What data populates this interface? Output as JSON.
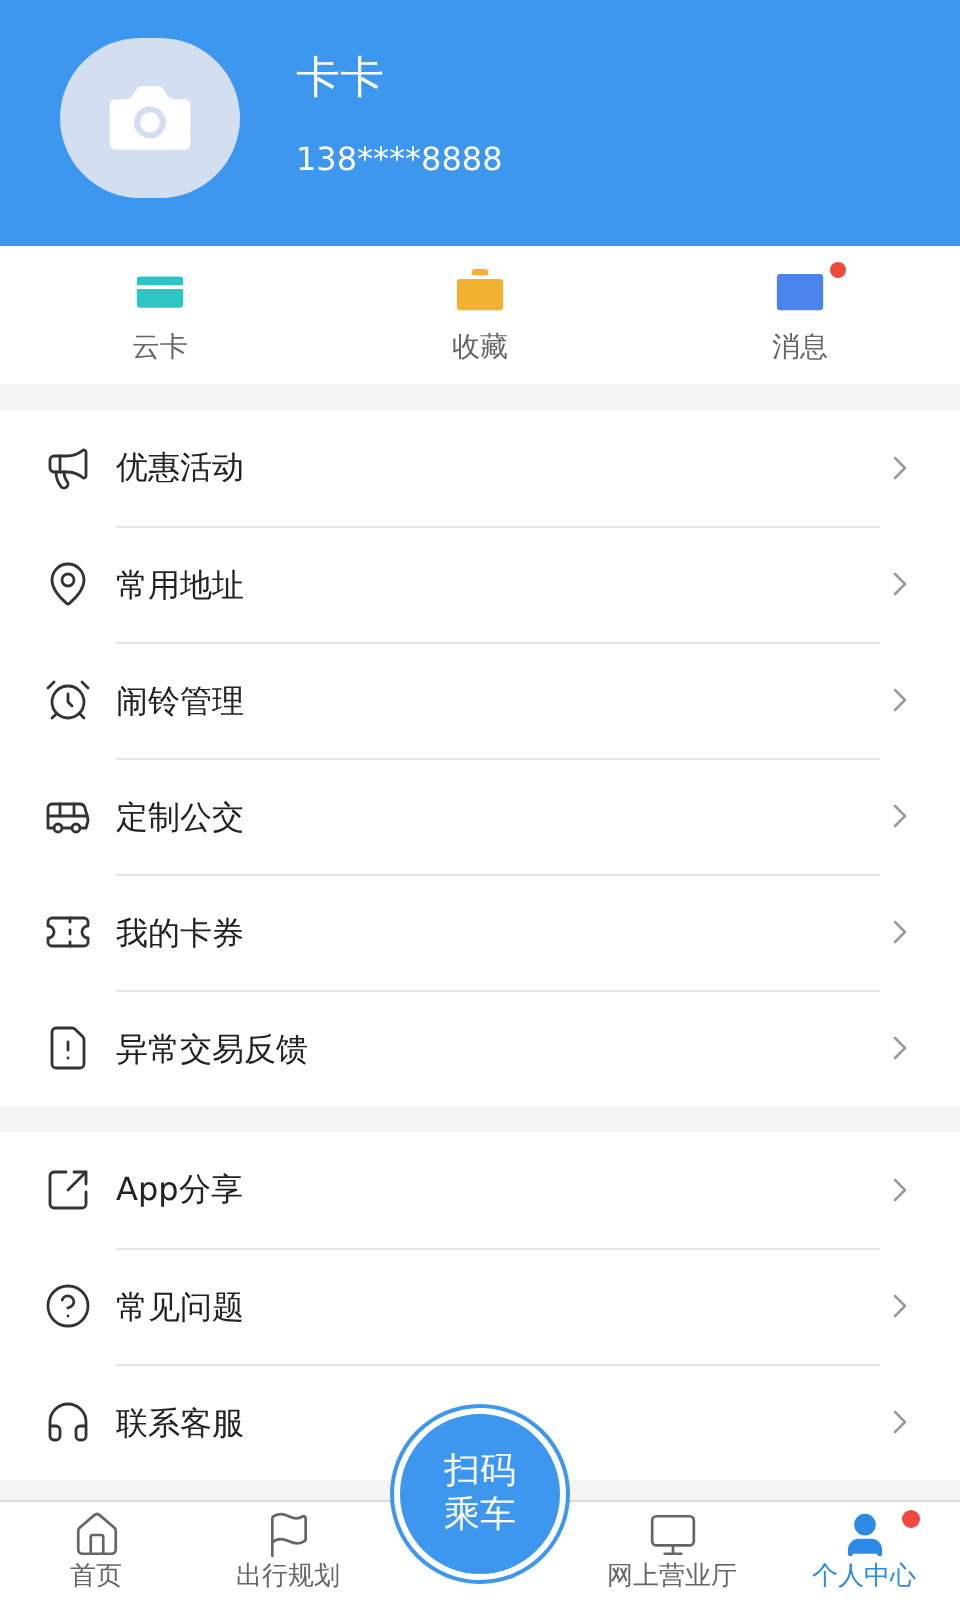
{
  "profile": {
    "name": "卡卡",
    "phone": "138****8888"
  },
  "shortcuts": [
    {
      "label": "云卡",
      "badge": false
    },
    {
      "label": "收藏",
      "badge": false
    },
    {
      "label": "消息",
      "badge": true
    }
  ],
  "sections": [
    {
      "items": [
        {
          "label": "优惠活动"
        },
        {
          "label": "常用地址"
        },
        {
          "label": "闹铃管理"
        },
        {
          "label": "定制公交"
        },
        {
          "label": "我的卡券"
        },
        {
          "label": "异常交易反馈"
        }
      ]
    },
    {
      "items": [
        {
          "label": "App分享"
        },
        {
          "label": "常见问题"
        },
        {
          "label": "联系客服"
        }
      ]
    }
  ],
  "tab_bar": {
    "items": [
      {
        "label": "首页",
        "selected": false,
        "badge": false
      },
      {
        "label": "出行规划",
        "selected": false,
        "badge": false
      },
      {
        "label": "网上营业厅",
        "selected": false,
        "badge": false
      },
      {
        "label": "个人中心",
        "selected": true,
        "badge": true
      }
    ],
    "scan_button": [
      "扫码",
      "乘车"
    ]
  }
}
